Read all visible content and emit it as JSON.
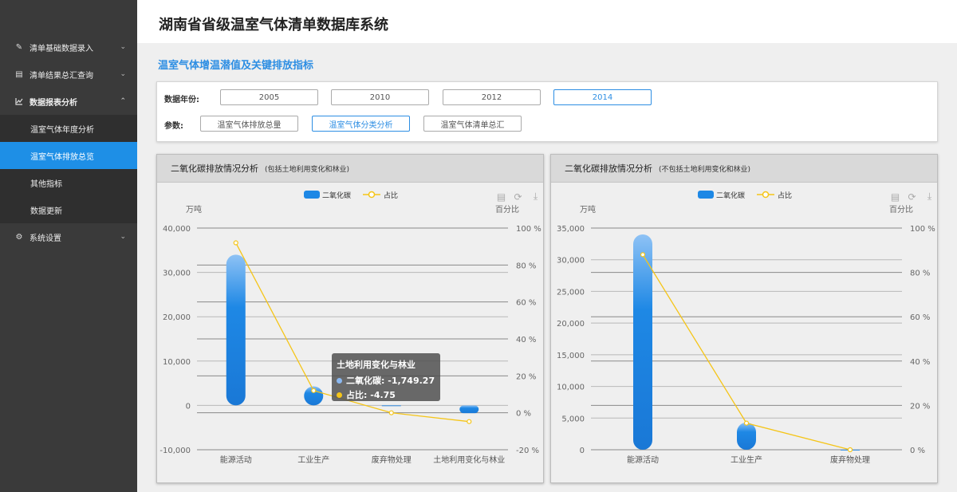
{
  "app": {
    "title": "湖南省省级温室气体清单数据库系统"
  },
  "sidebar": {
    "items": [
      {
        "label": "清单基础数据录入",
        "icon": "pencil-icon"
      },
      {
        "label": "清单结果总汇查询",
        "icon": "document-icon"
      },
      {
        "label": "数据报表分析",
        "icon": "chart-icon"
      }
    ],
    "subitems": [
      {
        "label": "温室气体年度分析"
      },
      {
        "label": "温室气体排放总览"
      },
      {
        "label": "其他指标"
      },
      {
        "label": "数据更新"
      }
    ],
    "settings": {
      "label": "系统设置",
      "icon": "gear-icon"
    },
    "active_sub": 1
  },
  "section": {
    "title": "温室气体增温潜值及关键排放指标"
  },
  "filter": {
    "year_label": "数据年份:",
    "years": [
      "2005",
      "2010",
      "2012",
      "2014"
    ],
    "selected_year": "2014",
    "param_label": "参数:",
    "params": [
      "温室气体排放总量",
      "温室气体分类分析",
      "温室气体清单总汇"
    ],
    "selected_param": "温室气体分类分析"
  },
  "colors": {
    "accent": "#2d8ee3",
    "bar": "#1e88e5",
    "line": "#f5c518"
  },
  "chart_data": [
    {
      "type": "bar",
      "title": "二氧化碳排放情况分析",
      "subtitle": "(包括土地利用变化和林业)",
      "categories": [
        "能源活动",
        "工业生产",
        "废弃物处理",
        "土地利用变化与林业"
      ],
      "series": [
        {
          "name": "二氧化碳",
          "type": "bar",
          "axis": "left",
          "values": [
            34000,
            4300,
            20,
            -1749.27
          ]
        },
        {
          "name": "占比",
          "type": "line",
          "axis": "right",
          "values": [
            92,
            12,
            0,
            -4.75
          ]
        }
      ],
      "ylabel": "万吨",
      "ylabel_right": "百分比",
      "ylim": [
        -10000,
        40000
      ],
      "yticks": [
        "-10,000",
        "0",
        "10,000",
        "20,000",
        "30,000",
        "40,000"
      ],
      "ylim_right": [
        -20,
        100
      ],
      "yticks_right": [
        "-20 %",
        "0 %",
        "20 %",
        "40 %",
        "60 %",
        "80 %",
        "100 %"
      ],
      "legend": "top-center",
      "grid": true
    },
    {
      "type": "bar",
      "title": "二氧化碳排放情况分析",
      "subtitle": "(不包括土地利用变化和林业)",
      "categories": [
        "能源活动",
        "工业生产",
        "废弃物处理"
      ],
      "series": [
        {
          "name": "二氧化碳",
          "type": "bar",
          "axis": "left",
          "values": [
            34000,
            4300,
            20
          ]
        },
        {
          "name": "占比",
          "type": "line",
          "axis": "right",
          "values": [
            88,
            12,
            0
          ]
        }
      ],
      "ylabel": "万吨",
      "ylabel_right": "百分比",
      "ylim": [
        0,
        35000
      ],
      "yticks": [
        "0",
        "5,000",
        "10,000",
        "15,000",
        "20,000",
        "25,000",
        "30,000",
        "35,000"
      ],
      "ylim_right": [
        0,
        100
      ],
      "yticks_right": [
        "0 %",
        "20 %",
        "40 %",
        "60 %",
        "80 %",
        "100 %"
      ],
      "legend": "top-center",
      "grid": true
    }
  ],
  "tooltip": {
    "title": "土地利用变化与林业",
    "rows": [
      {
        "label": "二氧化碳:",
        "value": "-1,749.27"
      },
      {
        "label": "占比:",
        "value": "-4.75"
      }
    ]
  }
}
